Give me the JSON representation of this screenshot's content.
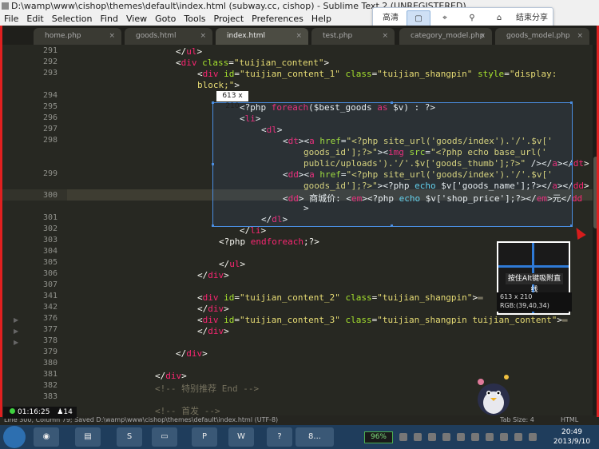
{
  "window": {
    "title": "D:\\wamp\\www\\cishop\\themes\\default\\index.html (subway.cc, cishop) - Sublime Text 2 (UNREGISTERED)"
  },
  "menu": [
    "File",
    "Edit",
    "Selection",
    "Find",
    "View",
    "Goto",
    "Tools",
    "Project",
    "Preferences",
    "Help"
  ],
  "capture_toolbar": {
    "hd": "高清",
    "share": "结束分享"
  },
  "tabs": [
    "home.php",
    "goods.html",
    "index.html",
    "test.php",
    "category_model.php",
    "goods_model.php"
  ],
  "active_tab": "index.html",
  "gutter_numbers": [
    "291",
    "292",
    "293",
    "",
    "294",
    "295",
    "296",
    "297",
    "298",
    "",
    "",
    "299",
    "",
    "300",
    "301",
    "302",
    "303",
    "304",
    "305",
    "306",
    "307",
    "341",
    "342",
    "376",
    "377",
    "378",
    "379",
    "380",
    "381",
    "382",
    "383"
  ],
  "selection": {
    "size": "613 x 210"
  },
  "magnifier": {
    "hint": "按住Alt键吸附直线",
    "size": "613 x 210",
    "rgb": "RGB:(39,40,34)"
  },
  "status": {
    "left": "Line 300, Column 79; Saved D:\\wamp\\www\\cishop\\themes\\default\\index.html (UTF-8)",
    "spaces": "Tab Size: 4",
    "syntax": "HTML"
  },
  "timer": {
    "time": "01:16:25",
    "count": "14"
  },
  "taskbar": {
    "battery": "96%",
    "time": "20:49",
    "date": "2013/9/10",
    "qq_label": "8..."
  }
}
